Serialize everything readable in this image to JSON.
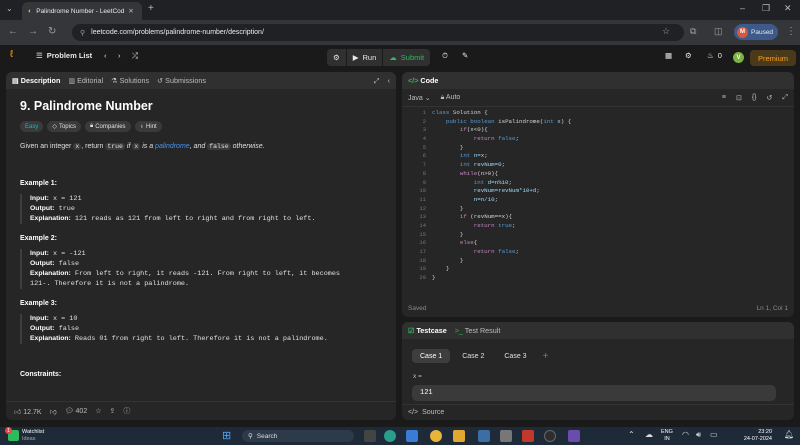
{
  "browser": {
    "tab_title": "Palindrome Number - LeetCode",
    "url": "leetcode.com/problems/palindrome-number/description/",
    "profile_initial": "M",
    "profile_status": "Paused"
  },
  "nav": {
    "problem_list": "Problem List",
    "run": "Run",
    "submit": "Submit",
    "streak": "0",
    "user_initial": "V",
    "premium": "Premium"
  },
  "desc": {
    "tabs": [
      "Description",
      "Editorial",
      "Solutions",
      "Submissions"
    ],
    "title": "9. Palindrome Number",
    "chips": {
      "difficulty": "Easy",
      "topics": "Topics",
      "companies": "Companies",
      "hint": "Hint"
    },
    "intro": {
      "p1": "Given an integer ",
      "x": "x",
      "p2": ", return ",
      "true": "true",
      "p3": " if ",
      "x2": "x",
      "p4": " is a ",
      "pal": "palindrome",
      "p5": ", and ",
      "false": "false",
      "p6": " otherwise."
    },
    "examples": [
      {
        "heading": "Example 1:",
        "input": "x = 121",
        "output": "true",
        "explanation": "121 reads as 121 from left to right and from right to left."
      },
      {
        "heading": "Example 2:",
        "input": "x = -121",
        "output": "false",
        "explanation": "From left to right, it reads -121. From right to left, it becomes",
        "explanation2": "121-. Therefore it is not a palindrome."
      },
      {
        "heading": "Example 3:",
        "input": "x = 10",
        "output": "false",
        "explanation": "Reads 01 from right to left. Therefore it is not a palindrome."
      }
    ],
    "labels": {
      "input": "Input:",
      "output": "Output:",
      "explanation": "Explanation:"
    },
    "constraints": "Constraints:",
    "footer": {
      "likes": "12.7K",
      "comments": "402"
    }
  },
  "code": {
    "header": "Code",
    "language": "Java",
    "mode": "Auto",
    "saved": "Saved",
    "cursor": "Ln 1, Col 1",
    "line_numbers": [
      "1",
      "2",
      "3",
      "4",
      "5",
      "6",
      "7",
      "8",
      "9",
      "10",
      "11",
      "12",
      "13",
      "14",
      "15",
      "16",
      "17",
      "18",
      "19",
      "20"
    ]
  },
  "testcase": {
    "tab": "Testcase",
    "result_tab": "Test Result",
    "cases": [
      "Case 1",
      "Case 2",
      "Case 3"
    ],
    "var_label": "x =",
    "value": "121",
    "source": "Source"
  },
  "taskbar": {
    "weather_title": "Watchlist",
    "weather_sub": "Ideas",
    "badge": "1",
    "search": "Search",
    "lang": "ENG",
    "region": "IN",
    "time": "23:20",
    "date": "24-07-2024"
  },
  "colors": {
    "leetcode_orange": "#ffa116",
    "easy": "#1cbaba",
    "submit_green": "#2cbb5d",
    "link_blue": "#4493f8"
  }
}
